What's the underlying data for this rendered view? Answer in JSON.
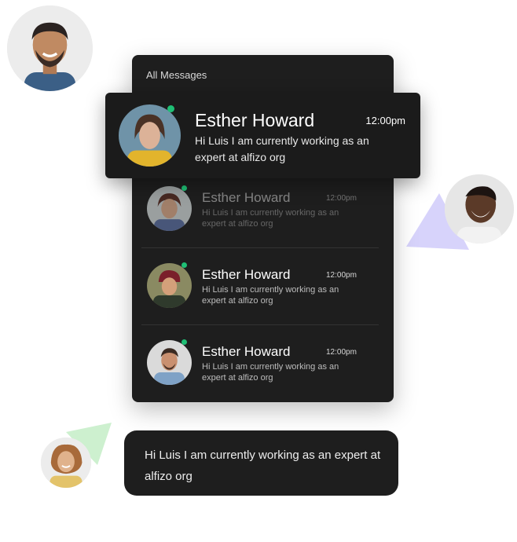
{
  "panel": {
    "title": "All Messages"
  },
  "featured": {
    "name": "Esther Howard",
    "time": "12:00pm",
    "message": "Hi Luis I am currently working as an expert at alfizo org",
    "online": true
  },
  "messages": [
    {
      "name": "Esther Howard",
      "time": "12:00pm",
      "message": "Hi Luis I am currently working as an expert at alfizo org",
      "online": true,
      "faded": true
    },
    {
      "name": "Esther Howard",
      "time": "12:00pm",
      "message": "Hi Luis I am currently working as an expert at alfizo org",
      "online": true,
      "faded": false
    },
    {
      "name": "Esther Howard",
      "time": "12:00pm",
      "message": "Hi Luis I am currently working as an expert at alfizo org",
      "online": true,
      "faded": false
    }
  ],
  "bubble": {
    "message": "Hi Luis I am currently working as an expert at alfizo org"
  },
  "colors": {
    "panel_bg": "#1e1e1e",
    "online": "#1fbf75",
    "triangle_purple": "#d7d3fb",
    "triangle_green": "#cdf0cf"
  },
  "icons": {
    "online_indicator": "online-status-dot"
  }
}
